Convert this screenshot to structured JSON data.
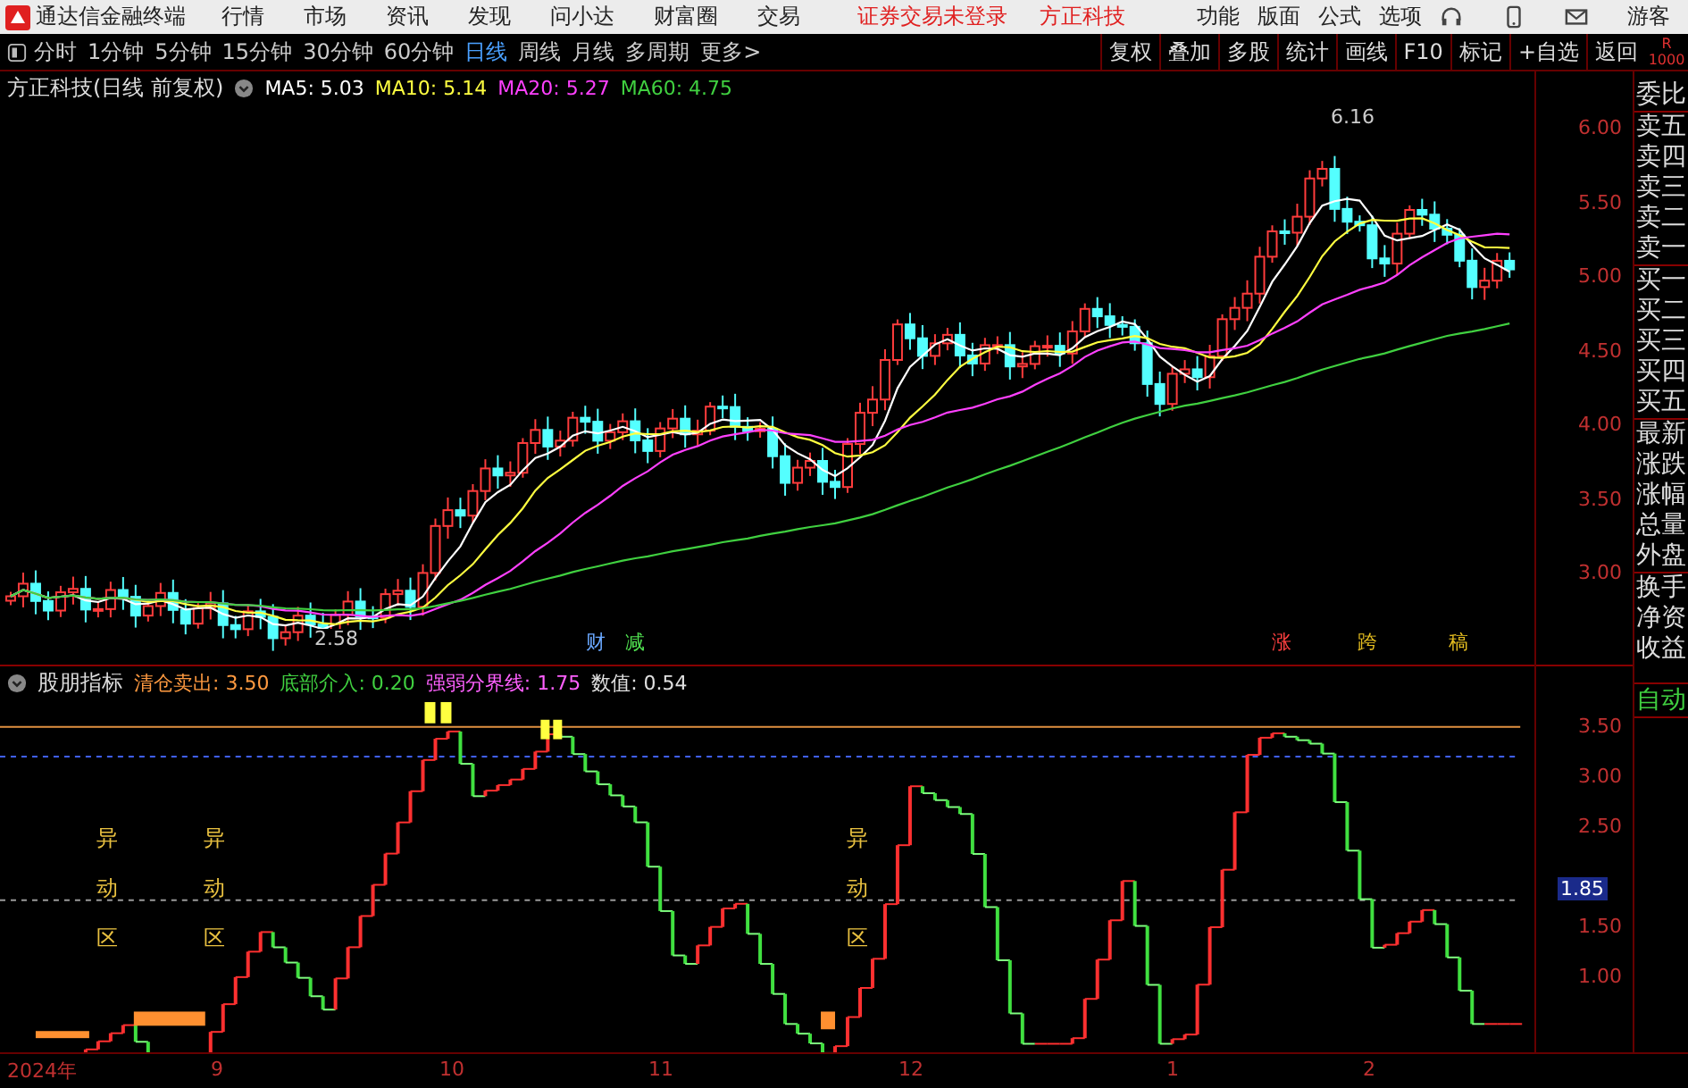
{
  "app_bar": {
    "title": "通达信金融终端",
    "menu": [
      "行情",
      "市场",
      "资讯",
      "发现",
      "问小达",
      "财富圈",
      "交易"
    ],
    "notices": [
      "证券交易未登录",
      "方正科技"
    ],
    "right_menu": [
      "功能",
      "版面",
      "公式",
      "选项"
    ],
    "user": "游客"
  },
  "toolbar": {
    "periods": [
      {
        "label": "分时",
        "selected": false
      },
      {
        "label": "1分钟",
        "selected": false
      },
      {
        "label": "5分钟",
        "selected": false
      },
      {
        "label": "15分钟",
        "selected": false
      },
      {
        "label": "30分钟",
        "selected": false
      },
      {
        "label": "60分钟",
        "selected": false
      },
      {
        "label": "日线",
        "selected": true
      },
      {
        "label": "周线",
        "selected": false
      },
      {
        "label": "月线",
        "selected": false
      },
      {
        "label": "多周期",
        "selected": false
      }
    ],
    "more": "更多>",
    "buttons": [
      "复权",
      "叠加",
      "多股",
      "统计",
      "画线",
      "F10",
      "标记",
      "+自选",
      "返回"
    ],
    "corner": [
      "R",
      "1000"
    ]
  },
  "price_chart": {
    "title": "方正科技(日线 前复权)",
    "ma": [
      {
        "label": "MA5: 5.03",
        "color": "#ffffff"
      },
      {
        "label": "MA10: 5.14",
        "color": "#ffff40"
      },
      {
        "label": "MA20: 5.27",
        "color": "#ff40ff"
      },
      {
        "label": "MA60: 4.75",
        "color": "#40d040"
      }
    ],
    "high_label": "6.16",
    "low_label": "2.58",
    "events": [
      {
        "label": "财",
        "color": "#6aa8ff"
      },
      {
        "label": "减",
        "color": "#50e050"
      },
      {
        "label": "涨",
        "color": "#ff4040"
      },
      {
        "label": "跨",
        "color": "#e8c020"
      },
      {
        "label": "稿",
        "color": "#e8c020"
      }
    ],
    "price_axis": [
      "6.00",
      "5.50",
      "5.00",
      "4.50",
      "4.00",
      "3.50",
      "3.00"
    ]
  },
  "indicator": {
    "name": "股朋指标",
    "params": [
      {
        "label": "清仓卖出: 3.50",
        "color": "#ff9a40"
      },
      {
        "label": "底部介入: 0.20",
        "color": "#40d040"
      },
      {
        "label": "强弱分界线: 1.75",
        "color": "#ff60ff"
      },
      {
        "label": "数值: 0.54",
        "color": "#e0e0e0"
      }
    ],
    "zone_labels": [
      "异动区",
      "异动区",
      "异动区"
    ],
    "axis": [
      "3.50",
      "3.00",
      "2.50",
      "1.50",
      "1.00"
    ],
    "current": "1.85"
  },
  "date_axis": [
    "2024年",
    "9",
    "10",
    "11",
    "12",
    "1",
    "2"
  ],
  "quote_panel": {
    "labels": [
      "委比",
      "卖五",
      "卖四",
      "卖三",
      "卖二",
      "卖一",
      "买一",
      "买二",
      "买三",
      "买四",
      "买五",
      "最新",
      "涨跌",
      "涨幅",
      "总量",
      "外盘",
      "换手",
      "净资",
      "收益"
    ],
    "mode": "自动"
  }
}
